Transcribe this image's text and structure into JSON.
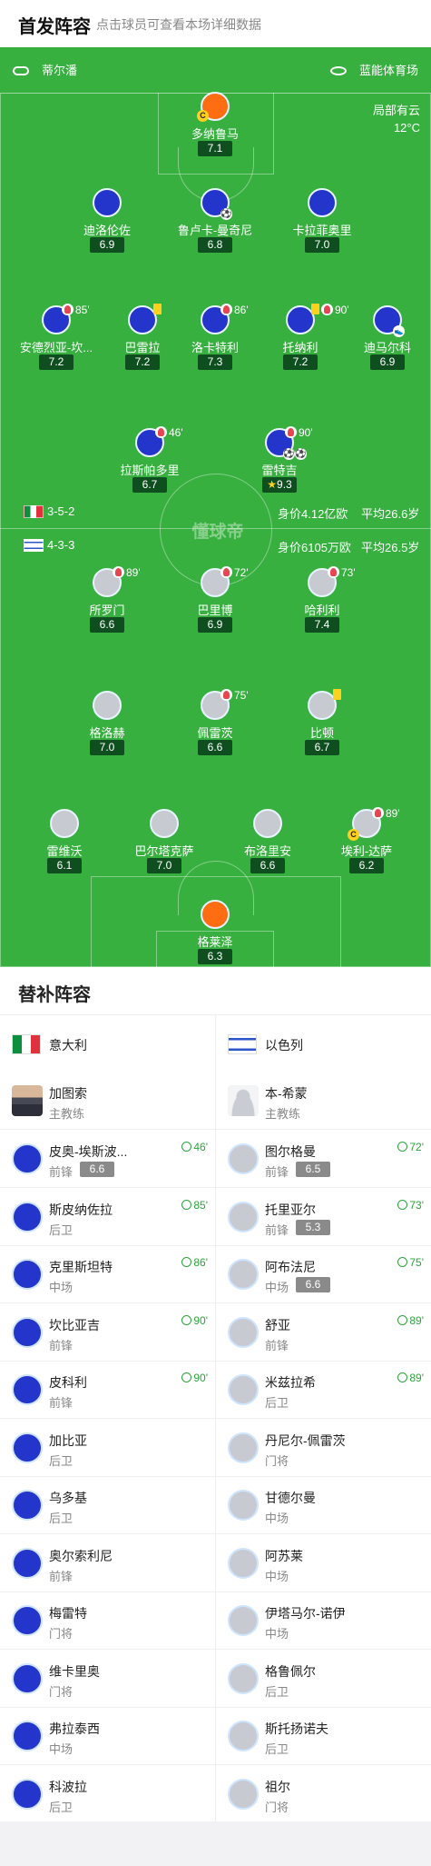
{
  "header": {
    "title": "首发阵容",
    "subtitle": "点击球员可查看本场详细数据"
  },
  "pitch_info": {
    "referee": "蒂尔潘",
    "stadium": "蓝能体育场",
    "weather": "局部有云",
    "temperature": "12°C",
    "watermark": "懂球帝"
  },
  "teams": {
    "home": {
      "formation": "3-5-2",
      "value": "身价4.12亿欧",
      "age": "平均26.6岁"
    },
    "away": {
      "formation": "4-3-3",
      "value": "身价6105万欧",
      "age": "平均26.5岁"
    }
  },
  "home_players": [
    {
      "name": "多纳鲁马",
      "rating": "7.1"
    },
    {
      "name": "迪洛伦佐",
      "rating": "6.9"
    },
    {
      "name": "鲁卢卡-曼奇尼",
      "rating": "6.8"
    },
    {
      "name": "卡拉菲奥里",
      "rating": "7.0"
    },
    {
      "name": "安德烈亚-坎...",
      "rating": "7.2",
      "sub": "85'"
    },
    {
      "name": "巴雷拉",
      "rating": "7.2"
    },
    {
      "name": "洛卡特利",
      "rating": "7.3",
      "sub": "86'"
    },
    {
      "name": "托纳利",
      "rating": "7.2",
      "sub": "90'"
    },
    {
      "name": "迪马尔科",
      "rating": "6.9"
    },
    {
      "name": "拉斯帕多里",
      "rating": "6.7",
      "sub": "46'"
    },
    {
      "name": "雷特吉",
      "rating": "9.3",
      "sub": "90'"
    }
  ],
  "away_players": [
    {
      "name": "所罗门",
      "rating": "6.6",
      "sub": "89'"
    },
    {
      "name": "巴里博",
      "rating": "6.9",
      "sub": "72'"
    },
    {
      "name": "哈利利",
      "rating": "7.4",
      "sub": "73'"
    },
    {
      "name": "格洛赫",
      "rating": "7.0"
    },
    {
      "name": "佩雷茨",
      "rating": "6.6",
      "sub": "75'"
    },
    {
      "name": "比顿",
      "rating": "6.7"
    },
    {
      "name": "雷维沃",
      "rating": "6.1"
    },
    {
      "name": "巴尔塔克萨",
      "rating": "7.0"
    },
    {
      "name": "布洛里安",
      "rating": "6.6"
    },
    {
      "name": "埃利-达萨",
      "rating": "6.2",
      "sub": "89'"
    },
    {
      "name": "格莱泽",
      "rating": "6.3"
    }
  ],
  "subs_section": {
    "title": "替补阵容",
    "home_team": "意大利",
    "away_team": "以色列",
    "home_coach": {
      "name": "加图索",
      "role": "主教练"
    },
    "away_coach": {
      "name": "本-希蒙",
      "role": "主教练"
    },
    "home_subs": [
      {
        "name": "皮奥-埃斯波...",
        "pos": "前锋",
        "rating": "6.6",
        "minute": "46'"
      },
      {
        "name": "斯皮纳佐拉",
        "pos": "后卫",
        "minute": "85'"
      },
      {
        "name": "克里斯坦特",
        "pos": "中场",
        "minute": "86'"
      },
      {
        "name": "坎比亚吉",
        "pos": "前锋",
        "minute": "90'"
      },
      {
        "name": "皮科利",
        "pos": "前锋",
        "minute": "90'"
      },
      {
        "name": "加比亚",
        "pos": "后卫"
      },
      {
        "name": "乌多基",
        "pos": "后卫"
      },
      {
        "name": "奥尔索利尼",
        "pos": "前锋"
      },
      {
        "name": "梅雷特",
        "pos": "门将"
      },
      {
        "name": "维卡里奥",
        "pos": "门将"
      },
      {
        "name": "弗拉泰西",
        "pos": "中场"
      },
      {
        "name": "科波拉",
        "pos": "后卫"
      }
    ],
    "away_subs": [
      {
        "name": "图尔格曼",
        "pos": "前锋",
        "rating": "6.5",
        "minute": "72'"
      },
      {
        "name": "托里亚尔",
        "pos": "前锋",
        "rating": "5.3",
        "minute": "73'"
      },
      {
        "name": "阿布法尼",
        "pos": "中场",
        "rating": "6.6",
        "minute": "75'"
      },
      {
        "name": "舒亚",
        "pos": "前锋",
        "minute": "89'"
      },
      {
        "name": "米兹拉希",
        "pos": "后卫",
        "minute": "89'"
      },
      {
        "name": "丹尼尔-佩雷茨",
        "pos": "门将"
      },
      {
        "name": "甘德尔曼",
        "pos": "中场"
      },
      {
        "name": "阿苏莱",
        "pos": "中场"
      },
      {
        "name": "伊塔马尔-诺伊",
        "pos": "中场"
      },
      {
        "name": "格鲁佩尔",
        "pos": "后卫"
      },
      {
        "name": "斯托扬诺夫",
        "pos": "后卫"
      },
      {
        "name": "祖尔",
        "pos": "门将"
      }
    ]
  },
  "colors": {
    "pitch": "#37b03f",
    "home_kit": "#2435cc",
    "away_kit": "#c7cbd1",
    "keeper_kit": "#ff6d12",
    "rating_bg": "#0f4f1f"
  }
}
